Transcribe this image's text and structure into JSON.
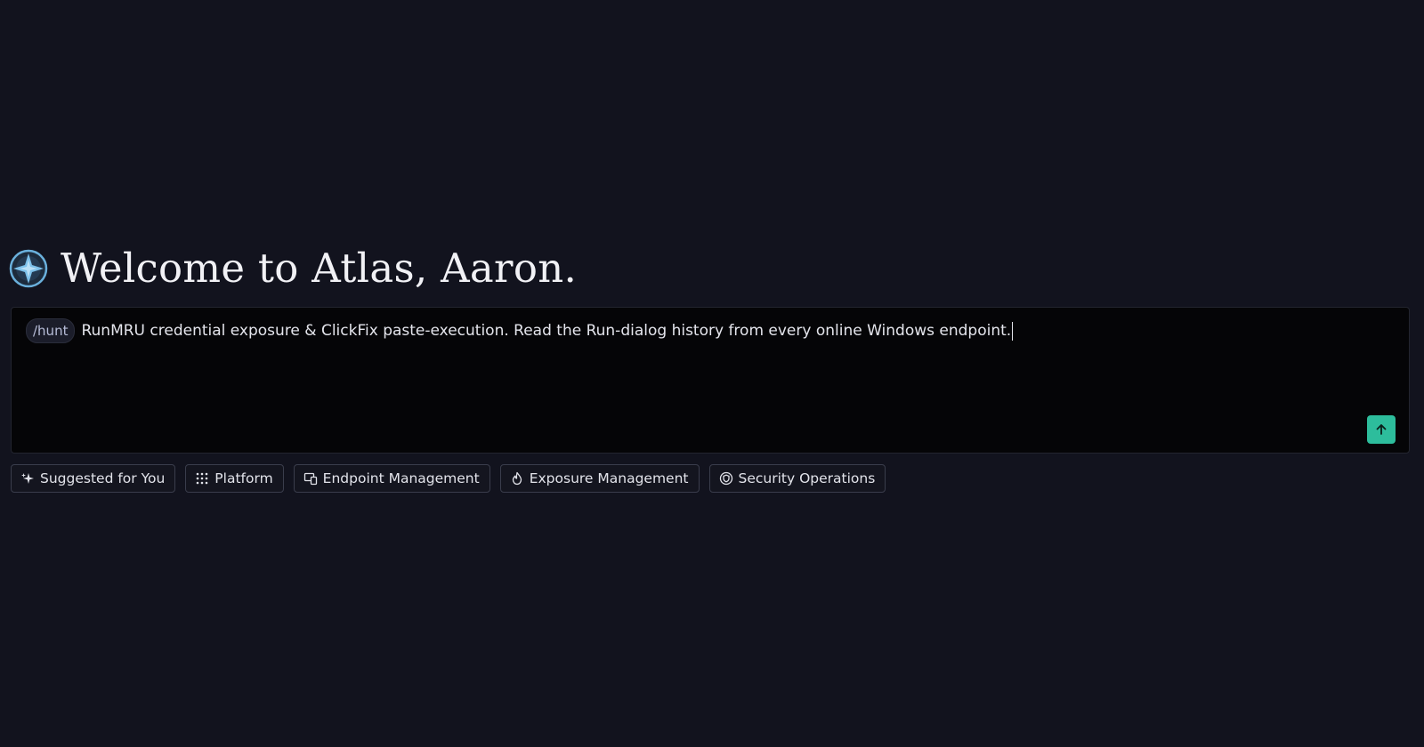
{
  "welcome": {
    "logo_icon": "atlas-compass-star-icon",
    "title": "Welcome to Atlas, Aaron."
  },
  "prompt": {
    "command": "/hunt",
    "text": "RunMRU credential exposure & ClickFix paste-execution. Read the Run-dialog history from every online Windows endpoint.",
    "send_icon": "arrow-up-icon",
    "send_color": "#2dbd9c"
  },
  "chips": [
    {
      "label": "Suggested for You",
      "icon": "sparkle-icon"
    },
    {
      "label": "Platform",
      "icon": "grid-dots-icon"
    },
    {
      "label": "Endpoint Management",
      "icon": "devices-icon"
    },
    {
      "label": "Exposure Management",
      "icon": "flame-icon"
    },
    {
      "label": "Security Operations",
      "icon": "shield-badge-icon"
    }
  ],
  "colors": {
    "background": "#12131e",
    "input_background": "#050507",
    "accent": "#2dbd9c",
    "logo_accent": "#6ab0dc"
  }
}
